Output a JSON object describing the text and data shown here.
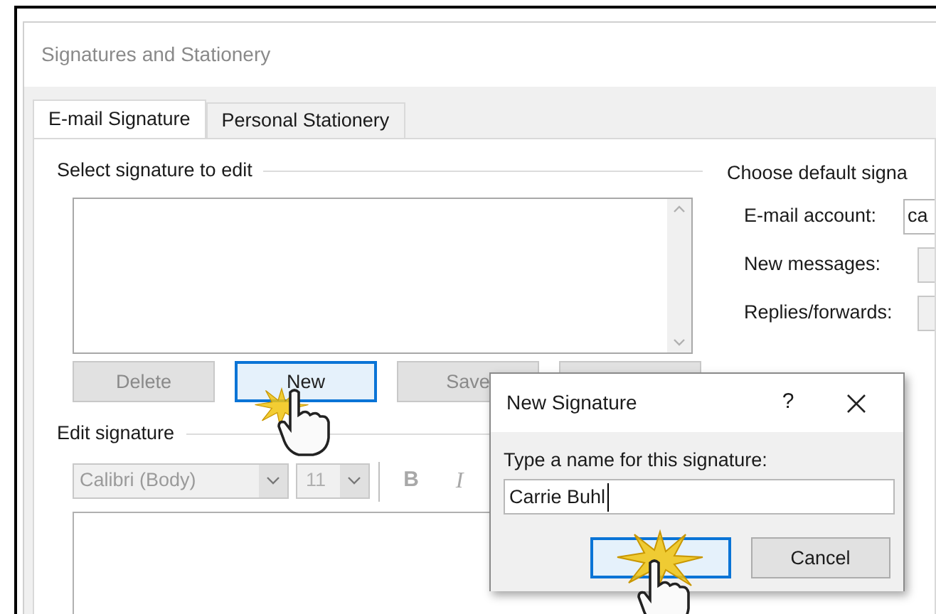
{
  "window": {
    "title": "Signatures and Stationery"
  },
  "tabs": [
    {
      "label": "E-mail Signature",
      "selected": true
    },
    {
      "label": "Personal Stationery",
      "selected": false
    }
  ],
  "select_section": {
    "heading": "Select signature to edit",
    "buttons": [
      {
        "label": "Delete",
        "disabled": true,
        "focused": false
      },
      {
        "label": "New",
        "disabled": false,
        "focused": true
      },
      {
        "label": "Save",
        "disabled": true,
        "focused": false
      },
      {
        "focused": false
      }
    ]
  },
  "edit_section": {
    "heading": "Edit signature",
    "font": "Calibri (Body)",
    "size": "11",
    "bold": "B",
    "italic": "I"
  },
  "defaults": {
    "heading": "Choose default signa",
    "fields": [
      {
        "label": "E-mail account:",
        "value": "ca"
      },
      {
        "label": "New messages:"
      },
      {
        "label": "Replies/forwards:"
      }
    ]
  },
  "new_signature_dialog": {
    "title": "New Signature",
    "help": "?",
    "prompt": "Type a name for this signature:",
    "value": "Carrie Buhl",
    "buttons": [
      {
        "focused": true
      },
      {
        "label": "Cancel",
        "focused": false
      }
    ]
  }
}
